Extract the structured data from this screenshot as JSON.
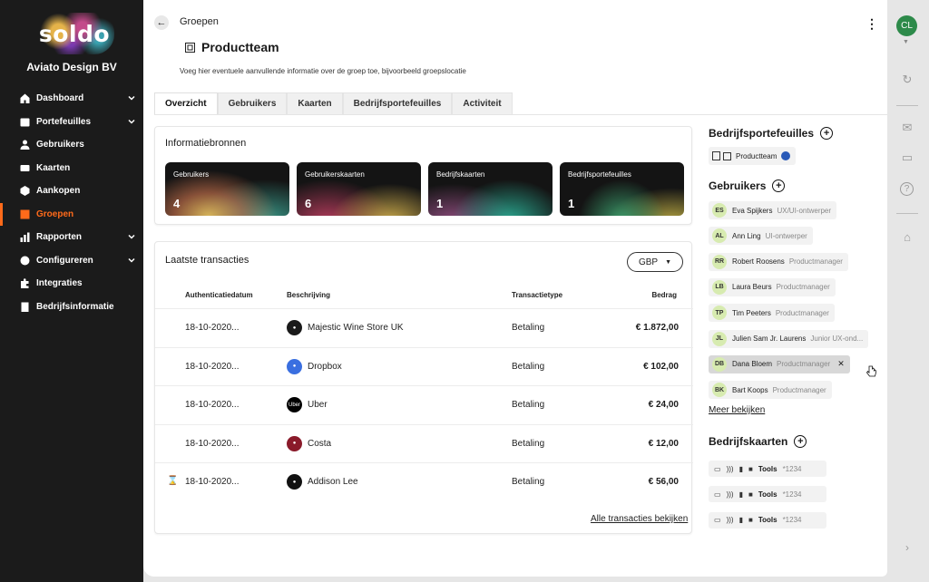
{
  "brand": {
    "logo": "soldo",
    "company": "Aviato Design BV"
  },
  "nav": [
    {
      "label": "Dashboard",
      "icon": "home-icon",
      "chevron": true
    },
    {
      "label": "Portefeuilles",
      "icon": "wallet-icon",
      "chevron": true
    },
    {
      "label": "Gebruikers",
      "icon": "user-icon",
      "chevron": false
    },
    {
      "label": "Kaarten",
      "icon": "cards-icon",
      "chevron": false
    },
    {
      "label": "Aankopen",
      "icon": "purchase-icon",
      "chevron": false
    },
    {
      "label": "Groepen",
      "icon": "groups-icon",
      "chevron": false,
      "active": true
    },
    {
      "label": "Rapporten",
      "icon": "chart-icon",
      "chevron": true
    },
    {
      "label": "Configureren",
      "icon": "gear-icon",
      "chevron": true
    },
    {
      "label": "Integraties",
      "icon": "puzzle-icon",
      "chevron": false
    },
    {
      "label": "Bedrijfsinformatie",
      "icon": "building-icon",
      "chevron": false
    }
  ],
  "header": {
    "breadcrumb": "Groepen",
    "title": "Productteam",
    "description": "Voeg hier eventuele aanvullende informatie over de groep toe, bijvoorbeeld groepslocatie"
  },
  "tabs": [
    "Overzicht",
    "Gebruikers",
    "Kaarten",
    "Bedrijfsportefeuilles",
    "Activiteit"
  ],
  "info": {
    "title": "Informatiebronnen",
    "tiles": [
      {
        "label": "Gebruikers",
        "value": "4"
      },
      {
        "label": "Gebruikerskaarten",
        "value": "6"
      },
      {
        "label": "Bedrijfskaarten",
        "value": "1"
      },
      {
        "label": "Bedrijfsportefeuilles",
        "value": "1"
      }
    ]
  },
  "transactions": {
    "title": "Laatste transacties",
    "currency": "GBP",
    "columns": [
      "Authenticatiedatum",
      "Beschrijving",
      "Transactietype",
      "Bedrag"
    ],
    "rows": [
      {
        "date": "18-10-2020...",
        "merchant": "Majestic Wine Store UK",
        "type": "Betaling",
        "amount": "€ 1.872,00",
        "color": "#1a1a1a"
      },
      {
        "date": "18-10-2020...",
        "merchant": "Dropbox",
        "type": "Betaling",
        "amount": "€ 102,00",
        "color": "#3a6fe0"
      },
      {
        "date": "18-10-2020...",
        "merchant": "Uber",
        "type": "Betaling",
        "amount": "€ 24,00",
        "color": "#000000",
        "mark": "Uber"
      },
      {
        "date": "18-10-2020...",
        "merchant": "Costa",
        "type": "Betaling",
        "amount": "€ 12,00",
        "color": "#8a1a2a"
      },
      {
        "date": "18-10-2020...",
        "merchant": "Addison Lee",
        "type": "Betaling",
        "amount": "€ 56,00",
        "color": "#111111",
        "pending": true
      }
    ],
    "all_link": "Alle transacties bekijken"
  },
  "side": {
    "wallets_title": "Bedrijfsportefeuilles",
    "wallet_chip": "Productteam",
    "users_title": "Gebruikers",
    "users": [
      {
        "initials": "ES",
        "name": "Eva Spijkers",
        "role": "UX/UI-ontwerper"
      },
      {
        "initials": "AL",
        "name": "Ann Ling",
        "role": "UI-ontwerper"
      },
      {
        "initials": "RR",
        "name": "Robert Roosens",
        "role": "Productmanager"
      },
      {
        "initials": "LB",
        "name": "Laura Beurs",
        "role": "Productmanager"
      },
      {
        "initials": "TP",
        "name": "Tim Peeters",
        "role": "Productmanager"
      },
      {
        "initials": "JL",
        "name": "Julien Sam Jr. Laurens",
        "role": "Junior UX-ond..."
      },
      {
        "initials": "DB",
        "name": "Dana Bloem",
        "role": "Productmanager",
        "hover": true
      },
      {
        "initials": "BK",
        "name": "Bart Koops",
        "role": "Productmanager"
      }
    ],
    "more": "Meer bekijken",
    "cards_title": "Bedrijfskaarten",
    "cards": [
      {
        "label": "Tools",
        "number": "*1234"
      },
      {
        "label": "Tools",
        "number": "*1234"
      },
      {
        "label": "Tools",
        "number": "*1234"
      }
    ]
  },
  "rail": {
    "initials": "CL"
  },
  "colors": {
    "accent": "#ff6a1a",
    "sidebar": "#1b1b1b",
    "avatar": "#2d8a4a"
  }
}
